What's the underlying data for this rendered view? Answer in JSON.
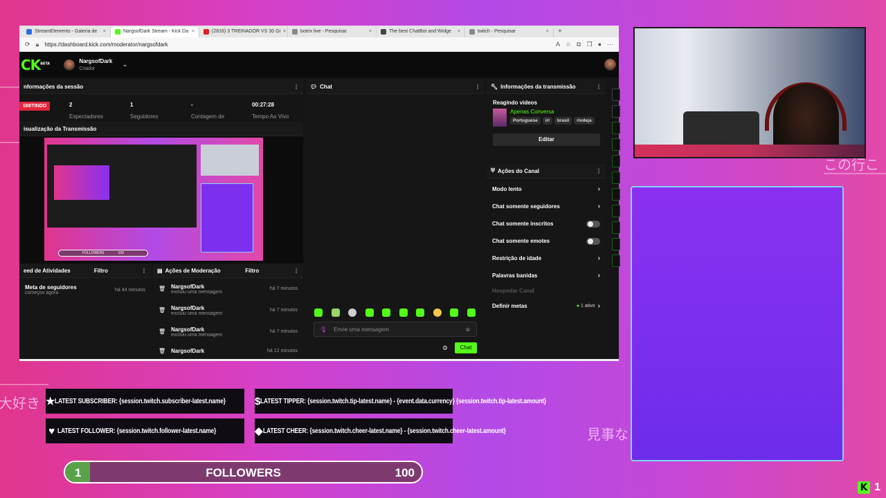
{
  "browser": {
    "tabs": [
      {
        "label": "StreamElements - Galeria de",
        "color": "#2d6cdf",
        "active": false
      },
      {
        "label": "NargsofDark Stream - Kick Da",
        "color": "#53fc18",
        "active": true
      },
      {
        "label": "(2816) 3 TREINADOR VS 30 Gi",
        "color": "#e02020",
        "active": false
      },
      {
        "label": "botrix live - Pesquisar",
        "color": "#888888",
        "active": false
      },
      {
        "label": "The best ChatBot and Widge",
        "color": "#444444",
        "active": false
      },
      {
        "label": "twitch - Pesquisar",
        "color": "#888888",
        "active": false
      }
    ],
    "new_tab": "+",
    "url": "https://dashboard.kick.com/moderator/nargsofdark"
  },
  "header": {
    "logo": "CK",
    "beta": "BETA",
    "channel_name": "NargsofDark",
    "channel_role": "Criador"
  },
  "session": {
    "title": "nformações da sessão",
    "live_badge": "SMITINDO",
    "stats": [
      {
        "value": "2",
        "label": "Espectadores"
      },
      {
        "value": "1",
        "label": "Seguidores"
      },
      {
        "value": "-",
        "label": "Contagem de"
      },
      {
        "value": "00:27:28",
        "label": "Tempo Ao Vivo"
      }
    ]
  },
  "preview": {
    "title": "isualização da Transmissão",
    "followers_label": "FOLLOWERS",
    "followers_goal": "100"
  },
  "activity": {
    "title": "eed de Atividades",
    "filter": "Filtro",
    "items": [
      {
        "title": "Meta de seguidores",
        "sub": "começou agora",
        "time": "há 44 minutos"
      }
    ]
  },
  "moderation": {
    "title": "Ações de Moderação",
    "filter": "Filtro",
    "items": [
      {
        "user": "NargsofDark",
        "action": "excluiu uma mensagem",
        "time": "há 7 minutos"
      },
      {
        "user": "NargsofDark",
        "action": "excluiu uma mensagem",
        "time": "há 7 minutos"
      },
      {
        "user": "NargsofDark",
        "action": "excluiu uma mensagem",
        "time": "há 7 minutos"
      },
      {
        "user": "NargsofDark",
        "action": "",
        "time": "há 12 minutos"
      }
    ]
  },
  "chat": {
    "title": "Chat",
    "placeholder": "Envie uma mensagem",
    "send": "Chat"
  },
  "broadcast": {
    "title": "Informações da transmissão",
    "stream_title": "Reagindo videos",
    "category": "Apenas Conversa",
    "tags": [
      "Portuguese",
      "irl",
      "brasil",
      "riodeja"
    ],
    "edit": "Editar"
  },
  "channel_actions": {
    "title": "Ações do Canal",
    "items": [
      {
        "label": "Modo lento",
        "control": "arrow"
      },
      {
        "label": "Chat somente seguidores",
        "control": "arrow"
      },
      {
        "label": "Chat somente inscritos",
        "control": "toggle"
      },
      {
        "label": "Chat somente emotes",
        "control": "toggle"
      },
      {
        "label": "Restrição de idade",
        "control": "arrow"
      },
      {
        "label": "Palavras banidas",
        "control": "arrow"
      },
      {
        "label": "Hospedar Canal",
        "control": "none"
      },
      {
        "label": "Definir metas",
        "control": "arrow"
      }
    ],
    "goals_status": "1 ativo"
  },
  "overlay": {
    "latest_subscriber": "LATEST SUBSCRIBER: {session.twitch.subscriber-latest.name}",
    "latest_tipper": "LATEST TIPPER: {session.twitch.tip-latest.name} - {event.data.currency} {session.twitch.tip-latest.amount}",
    "latest_follower": "LATEST FOLLOWER: {session.twitch.follower-latest.name}",
    "latest_cheer": "LATEST CHEER: {session.twitch.cheer-latest.name} - {session.twitch.cheer-latest.amount}",
    "followers_goal": {
      "current": "1",
      "label": "FOLLOWERS",
      "target": "100",
      "progress": 0.07
    },
    "jp_left": "大好き",
    "jp_right": "この行こ",
    "jp_bottom": "見事な",
    "kick_count": "1",
    "kick_logo": "K"
  },
  "colors": {
    "kick_green": "#53fc18",
    "live_red": "#e0263c",
    "chatbox_purple": "#7d2fee"
  }
}
